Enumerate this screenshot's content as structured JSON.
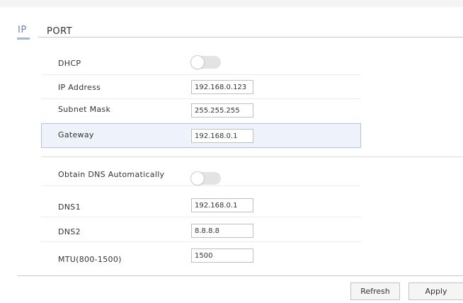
{
  "tabs": [
    {
      "label": "IP",
      "active": true
    },
    {
      "label": "PORT",
      "active": false
    }
  ],
  "form": {
    "dhcp": {
      "label": "DHCP",
      "enabled": false
    },
    "ip_address": {
      "label": "IP Address",
      "value": "192.168.0.123"
    },
    "subnet_mask": {
      "label": "Subnet Mask",
      "value": "255.255.255"
    },
    "gateway": {
      "label": "Gateway",
      "value": "192.168.0.1"
    },
    "obtain_dns": {
      "label": "Obtain DNS Automatically",
      "enabled": false
    },
    "dns1": {
      "label": "DNS1",
      "value": "192.168.0.1"
    },
    "dns2": {
      "label": "DNS2",
      "value": "8.8.8.8"
    },
    "mtu": {
      "label": "MTU(800-1500)",
      "value": "1500"
    }
  },
  "actions": {
    "refresh_label": "Refresh",
    "apply_label": "Apply"
  },
  "colors": {
    "active_tab": "#6d86b0",
    "highlight_bg": "#eef2fb",
    "highlight_border": "#b5c3e3"
  }
}
